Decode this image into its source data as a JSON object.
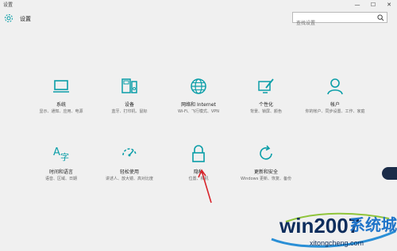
{
  "window": {
    "title": "设置",
    "minimize": "—",
    "maximize": "☐",
    "close": "✕"
  },
  "header": {
    "title": "设置",
    "search_placeholder": "查找设置"
  },
  "tiles": [
    {
      "name": "系统",
      "desc": "显示、通知、应用、电源",
      "icon": "laptop-icon"
    },
    {
      "name": "设备",
      "desc": "蓝牙、打印机、鼠标",
      "icon": "devices-icon"
    },
    {
      "name": "网络和 Internet",
      "desc": "Wi-Fi、飞行模式、VPN",
      "icon": "globe-icon"
    },
    {
      "name": "个性化",
      "desc": "背景、锁屏、颜色",
      "icon": "personalization-icon"
    },
    {
      "name": "帐户",
      "desc": "你的帐户、同步设置、工作、家庭",
      "icon": "account-icon"
    },
    {
      "name": "时间和语言",
      "desc": "语音、区域、日期",
      "icon": "time-language-icon"
    },
    {
      "name": "轻松使用",
      "desc": "讲述人、放大镜、高对比度",
      "icon": "ease-of-access-icon"
    },
    {
      "name": "隐私",
      "desc": "位置、相机",
      "icon": "lock-icon"
    },
    {
      "name": "更新和安全",
      "desc": "Windows 更新、恢复、备份",
      "icon": "update-icon"
    }
  ],
  "watermark": {
    "text": "win2007",
    "text2": "系统城",
    "url": "xitongcheng.com"
  },
  "colors": {
    "accent": "#0a9ea8",
    "background": "#f0f0f0",
    "arrow": "#d8232a"
  }
}
